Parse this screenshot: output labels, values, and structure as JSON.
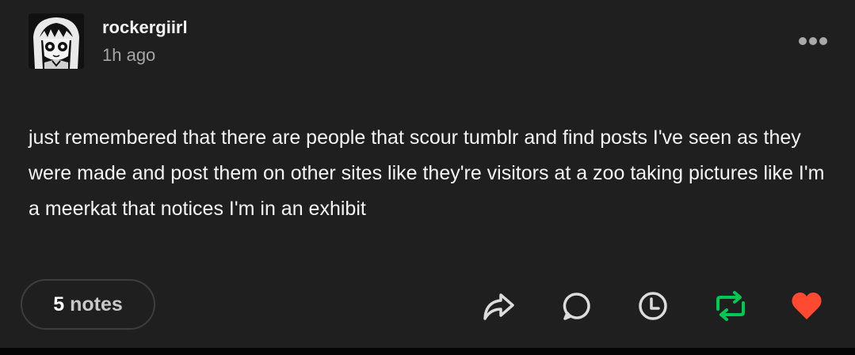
{
  "post": {
    "author": {
      "username": "rockergiirl",
      "timestamp": "1h ago",
      "avatar_icon": "avatar-image"
    },
    "menu_icon": "more-options-icon",
    "body": "just remembered that there are people that scour tumblr and find posts I've seen as they were made and post them on other sites like they're visitors at a zoo taking pictures like I'm a meerkat that notices I'm in an exhibit",
    "notes": {
      "count": "5",
      "label": "notes"
    },
    "actions": [
      {
        "name": "share",
        "icon": "share-icon"
      },
      {
        "name": "reply",
        "icon": "reply-icon"
      },
      {
        "name": "queue",
        "icon": "clock-icon"
      },
      {
        "name": "reblog",
        "icon": "reblog-icon",
        "color": "#00c853"
      },
      {
        "name": "like",
        "icon": "heart-icon",
        "color": "#ff4930",
        "state": "liked"
      }
    ],
    "colors": {
      "background": "#1f1f1f",
      "text": "#f4f4f4",
      "muted": "#a6a6a6",
      "reblog_green": "#00c853",
      "like_red": "#ff4930"
    }
  }
}
